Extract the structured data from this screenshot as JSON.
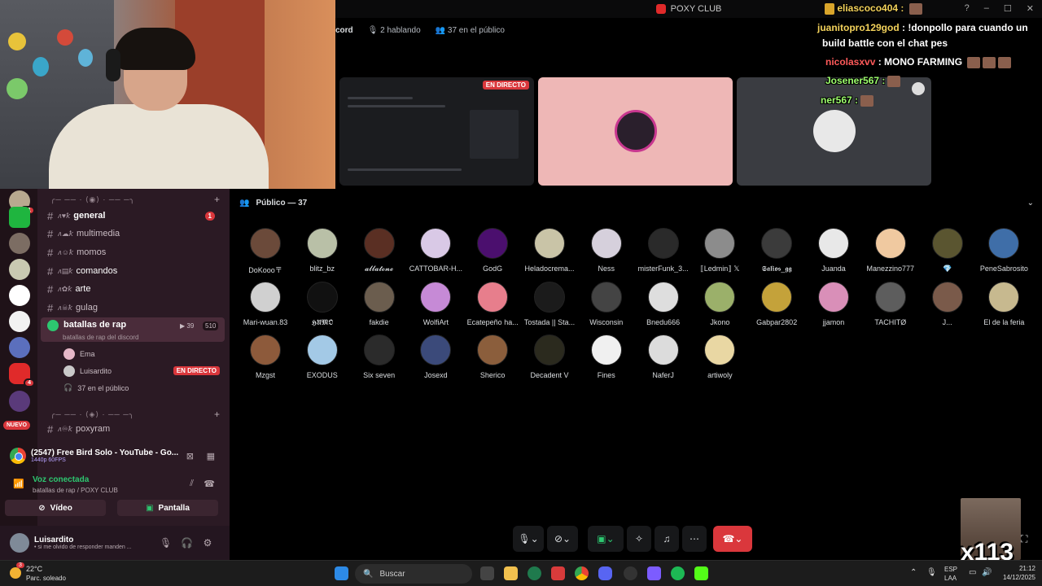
{
  "window": {
    "title": "POXY CLUB",
    "chat_user": "eliascoco404 :"
  },
  "voice_header": {
    "channel": "cord",
    "speaking": "2 hablando",
    "audience": "37 en el público"
  },
  "stage": {
    "live_badge": "EN DIRECTO"
  },
  "chat": [
    {
      "user": "juanitopro129god",
      "text": " : !donpollo para cuando un",
      "user_color": "#f3d25b"
    },
    {
      "user": "",
      "text": "build battle con el chat pes",
      "user_color": "#ffffff"
    },
    {
      "user": "nicolasxvv",
      "text": " : MONO FARMING",
      "user_color": "#ff5a5a"
    },
    {
      "user": "Josener567 :",
      "text": "",
      "user_color": "#9eff6e"
    },
    {
      "user": "ner567 :",
      "text": "",
      "user_color": "#9eff6e"
    }
  ],
  "sidebar": {
    "guild_badges": [
      "41",
      "4"
    ],
    "new_badge": "NUEVO",
    "categories": [
      "╭─ ── · ⟨◉⟩ · ── ─╮",
      "╭─ ── · ⟨◈⟩ · ── ─╮"
    ],
    "channels": [
      {
        "label": "general",
        "mention": "1"
      },
      {
        "label": "multimedia"
      },
      {
        "label": "momos"
      },
      {
        "label": "comandos"
      },
      {
        "label": "arte"
      },
      {
        "label": "gulag"
      }
    ],
    "voice_channel": {
      "label": "batallas de rap",
      "sub": "batallas de rap del discord",
      "cam_count": "39",
      "limit": "510"
    },
    "voice_users": [
      {
        "name": "Ema"
      },
      {
        "name": "Luisardito",
        "badge": "EN DIRECTO"
      }
    ],
    "voice_audience": "37 en el público",
    "channel_after": {
      "label": "poxyram"
    }
  },
  "activity": {
    "title": "(2547) Free Bird Solo - YouTube - Go...",
    "sub": "1440p 60FPS"
  },
  "voice_panel": {
    "status": "Voz conectada",
    "location": "batallas de rap / POXY CLUB",
    "video_label": "Vídeo",
    "screen_label": "Pantalla"
  },
  "user_panel": {
    "name": "Luisardito",
    "status": "• si me olvido de responder manden ..."
  },
  "audience": {
    "header": "Público — 37",
    "members": [
      {
        "name": "DoKooo〒",
        "color": "#6b4a3a"
      },
      {
        "name": "blitz_bz",
        "color": "#b9c0a7"
      },
      {
        "name": "𝓪𝓵𝓵𝓪𝓽𝓸𝓷𝓮",
        "color": "#5a2f23"
      },
      {
        "name": "CATTOBAR-H...",
        "color": "#d9c9e6"
      },
      {
        "name": "GodG",
        "color": "#4b0f6e"
      },
      {
        "name": "Heladocrema...",
        "color": "#c9c4a7"
      },
      {
        "name": "Ness",
        "color": "#d6d0dc"
      },
      {
        "name": "misterFunk_3...",
        "color": "#2a2a2a"
      },
      {
        "name": "⟦Ledmin⟧ 𝕏",
        "color": "#8c8c8c"
      },
      {
        "name": "𝕾𝖆𝖑𝖎𝖔𝖘_𝖌𝖌",
        "color": "#3b3b3b"
      },
      {
        "name": "Juanda",
        "color": "#e8e8e8"
      },
      {
        "name": "Manezzino777",
        "color": "#f0c9a0"
      },
      {
        "name": "💎",
        "color": "#5a5530"
      },
      {
        "name": "PeneSabrosito",
        "color": "#3f6ea8"
      },
      {
        "name": "Mari-wuan.83",
        "color": "#d0d0d0"
      },
      {
        "name": "𝕳𝖀𝕸𝕺",
        "color": "#111111"
      },
      {
        "name": "fakdie",
        "color": "#6b5d4e"
      },
      {
        "name": "WolfiArt",
        "color": "#c68ad6"
      },
      {
        "name": "Ecatepeño ha...",
        "color": "#e77e8c"
      },
      {
        "name": "Tostada || Sta...",
        "color": "#1b1b1b"
      },
      {
        "name": "Wisconsin",
        "color": "#444444"
      },
      {
        "name": "Bnedu666",
        "color": "#dedede"
      },
      {
        "name": "Jkono",
        "color": "#9bb06a"
      },
      {
        "name": "Gabpar2802",
        "color": "#c4a23a"
      },
      {
        "name": "jjamon",
        "color": "#d98fb8"
      },
      {
        "name": "TACHITØ",
        "color": "#5d5d5d"
      },
      {
        "name": "J...",
        "color": "#7a5a4a"
      },
      {
        "name": "El de la feria",
        "color": "#c7b98f"
      },
      {
        "name": "Mzgst",
        "color": "#8d5a3b"
      },
      {
        "name": "EXODUS",
        "color": "#a3c9e6"
      },
      {
        "name": "Six seven",
        "color": "#2b2b2b"
      },
      {
        "name": "Josexd",
        "color": "#3b4a7a"
      },
      {
        "name": "Sherico",
        "color": "#8b5e3c"
      },
      {
        "name": "Decadent V",
        "color": "#2b2a1e"
      },
      {
        "name": "Fines",
        "color": "#f0f0f0"
      },
      {
        "name": "NaferJ",
        "color": "#dcdcdc"
      },
      {
        "name": "artiwoly",
        "color": "#e9d7a3"
      }
    ]
  },
  "overlay": {
    "counter": "x113"
  },
  "taskbar": {
    "temp": "22°C",
    "weather": "Parc. soleado",
    "weather_badge": "3",
    "search_placeholder": "Buscar",
    "lang1": "ESP",
    "lang2": "LAA",
    "time": "21:12",
    "date": "14/12/2025"
  }
}
